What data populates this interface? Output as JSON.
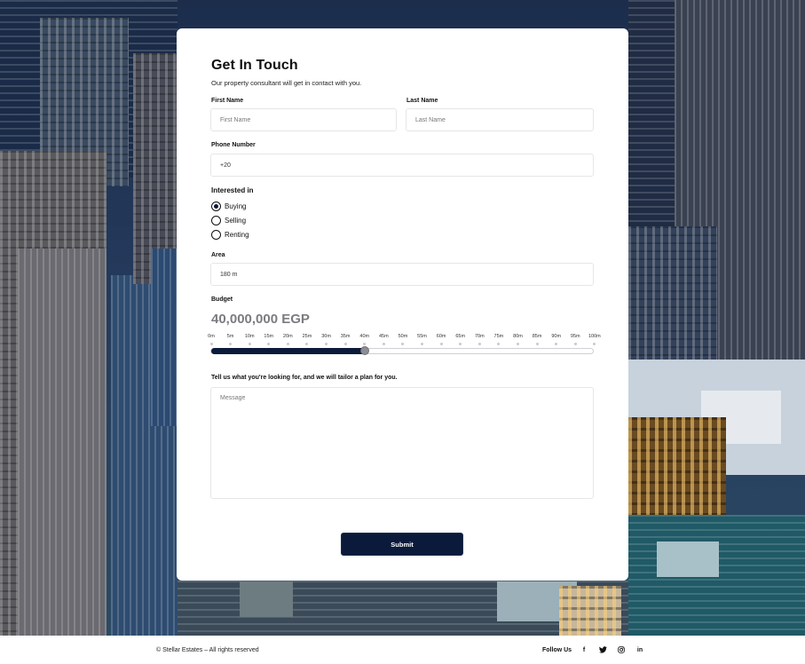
{
  "form": {
    "title": "Get In Touch",
    "subtitle": "Our property consultant will get in contact with you.",
    "first_name": {
      "label": "First Name",
      "placeholder": "First Name"
    },
    "last_name": {
      "label": "Last Name",
      "placeholder": "Last Name"
    },
    "phone": {
      "label": "Phone Number",
      "value": "+20"
    },
    "interest": {
      "label": "Interested in",
      "options": [
        {
          "label": "Buying",
          "selected": true
        },
        {
          "label": "Selling",
          "selected": false
        },
        {
          "label": "Renting",
          "selected": false
        }
      ]
    },
    "area": {
      "label": "Area",
      "value": "180 m"
    },
    "budget": {
      "label": "Budget",
      "value": "40,000,000 EGP",
      "ticks": [
        "0m",
        "5m",
        "10m",
        "15m",
        "20m",
        "25m",
        "30m",
        "35m",
        "40m",
        "45m",
        "50m",
        "55m",
        "60m",
        "65m",
        "70m",
        "75m",
        "80m",
        "85m",
        "90m",
        "95m",
        "100m"
      ],
      "fraction": 0.4
    },
    "message": {
      "label": "Tell us what you're looking for, and we will tailor a plan for you.",
      "placeholder": "Message"
    },
    "submit_label": "Submit"
  },
  "footer": {
    "copyright": "© Stellar Estates – All rights reserved",
    "follow_label": "Follow Us",
    "social": [
      {
        "icon": "facebook-icon",
        "glyph": "f"
      },
      {
        "icon": "twitter-icon",
        "glyph": "🐦"
      },
      {
        "icon": "instagram-icon",
        "glyph": "◎"
      },
      {
        "icon": "linkedin-icon",
        "glyph": "in"
      }
    ]
  },
  "colors": {
    "accent": "#0b1a3a",
    "budget_text": "#7b7b82"
  }
}
